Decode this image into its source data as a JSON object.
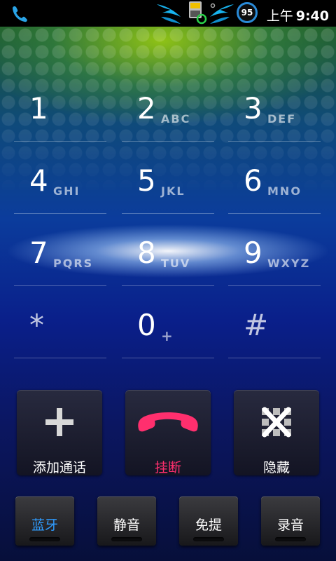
{
  "status_bar": {
    "battery_level": "95",
    "period": "上午",
    "time": "9:40"
  },
  "keypad": [
    {
      "digit": "1",
      "letters": ""
    },
    {
      "digit": "2",
      "letters": "ABC"
    },
    {
      "digit": "3",
      "letters": "DEF"
    },
    {
      "digit": "4",
      "letters": "GHI"
    },
    {
      "digit": "5",
      "letters": "JKL"
    },
    {
      "digit": "6",
      "letters": "MNO"
    },
    {
      "digit": "7",
      "letters": "PQRS"
    },
    {
      "digit": "8",
      "letters": "TUV"
    },
    {
      "digit": "9",
      "letters": "WXYZ"
    },
    {
      "digit": "*",
      "letters": ""
    },
    {
      "digit": "0",
      "letters": "+"
    },
    {
      "digit": "#",
      "letters": ""
    }
  ],
  "actions": {
    "add_call": "添加通话",
    "hang_up": "挂断",
    "hide": "隐藏"
  },
  "toggles": {
    "bluetooth": "蓝牙",
    "mute": "静音",
    "speaker": "免提",
    "record": "录音"
  },
  "colors": {
    "hang_up": "#ff2f6e",
    "bluetooth_label": "#2f9cff",
    "battery_ring": "#2a8bd8"
  }
}
